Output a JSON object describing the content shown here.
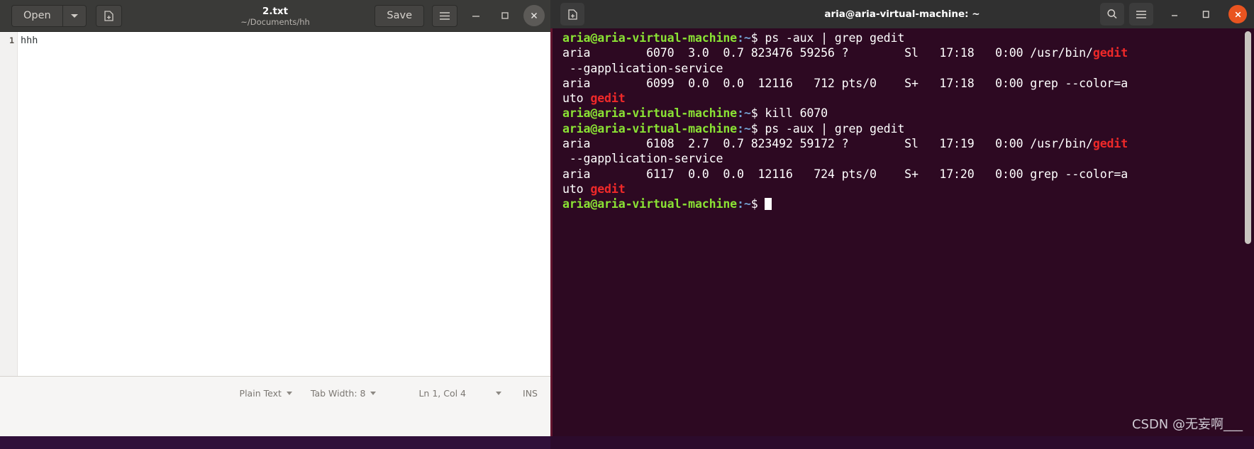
{
  "gedit": {
    "toolbar": {
      "open_label": "Open",
      "open_dropdown_icon": "chevron-down-icon",
      "new_document_icon": "new-document-icon",
      "save_label": "Save",
      "hamburger_icon": "hamburger-menu-icon",
      "minimize_icon": "minimize-icon",
      "maximize_icon": "maximize-icon",
      "close_icon": "close-icon"
    },
    "title": "2.txt",
    "subtitle": "~/Documents/hh",
    "document": {
      "line_number": "1",
      "text": "hhh"
    },
    "statusbar": {
      "language": "Plain Text",
      "tab_width": "Tab Width: 8",
      "position": "Ln 1, Col 4",
      "insert_mode": "INS"
    }
  },
  "terminal": {
    "title": "aria@aria-virtual-machine: ~",
    "new_tab_icon": "new-terminal-icon",
    "search_icon": "search-icon",
    "menu_icon": "hamburger-menu-icon",
    "minimize_icon": "minimize-icon",
    "maximize_icon": "maximize-icon",
    "close_icon": "close-icon",
    "prompt_user_host": "aria@aria-virtual-machine",
    "prompt_path": ":~",
    "prompt_symbol": "$",
    "lines": [
      {
        "type": "prompt",
        "command": " ps -aux | grep gedit"
      },
      {
        "type": "output",
        "pre": "aria        6070  3.0  0.7 823476 59256 ?        Sl   17:18   0:00 /usr/bin/",
        "highlight": "gedit",
        "post": ""
      },
      {
        "type": "output",
        "pre": " --gapplication-service",
        "highlight": "",
        "post": ""
      },
      {
        "type": "output",
        "pre": "aria        6099  0.0  0.0  12116   712 pts/0    S+   17:18   0:00 grep --color=a",
        "highlight": "",
        "post": ""
      },
      {
        "type": "output",
        "pre": "uto ",
        "highlight": "gedit",
        "post": ""
      },
      {
        "type": "prompt",
        "command": " kill 6070"
      },
      {
        "type": "prompt",
        "command": " ps -aux | grep gedit"
      },
      {
        "type": "output",
        "pre": "aria        6108  2.7  0.7 823492 59172 ?        Sl   17:19   0:00 /usr/bin/",
        "highlight": "gedit",
        "post": ""
      },
      {
        "type": "output",
        "pre": " --gapplication-service",
        "highlight": "",
        "post": ""
      },
      {
        "type": "output",
        "pre": "aria        6117  0.0  0.0  12116   724 pts/0    S+   17:20   0:00 grep --color=a",
        "highlight": "",
        "post": ""
      },
      {
        "type": "output",
        "pre": "uto ",
        "highlight": "gedit",
        "post": ""
      },
      {
        "type": "prompt-cursor",
        "command": " "
      }
    ]
  },
  "watermark": "CSDN @无妄啊___",
  "colors": {
    "terminal_background": "#2d0922",
    "terminal_border": "#63142f",
    "prompt_green": "#8ae234",
    "prompt_blue": "#729fcf",
    "highlight_red": "#ef2929",
    "headerbar_gedit": "#3a3a38",
    "headerbar_terminal": "#303030",
    "close_accent": "#e95420"
  }
}
